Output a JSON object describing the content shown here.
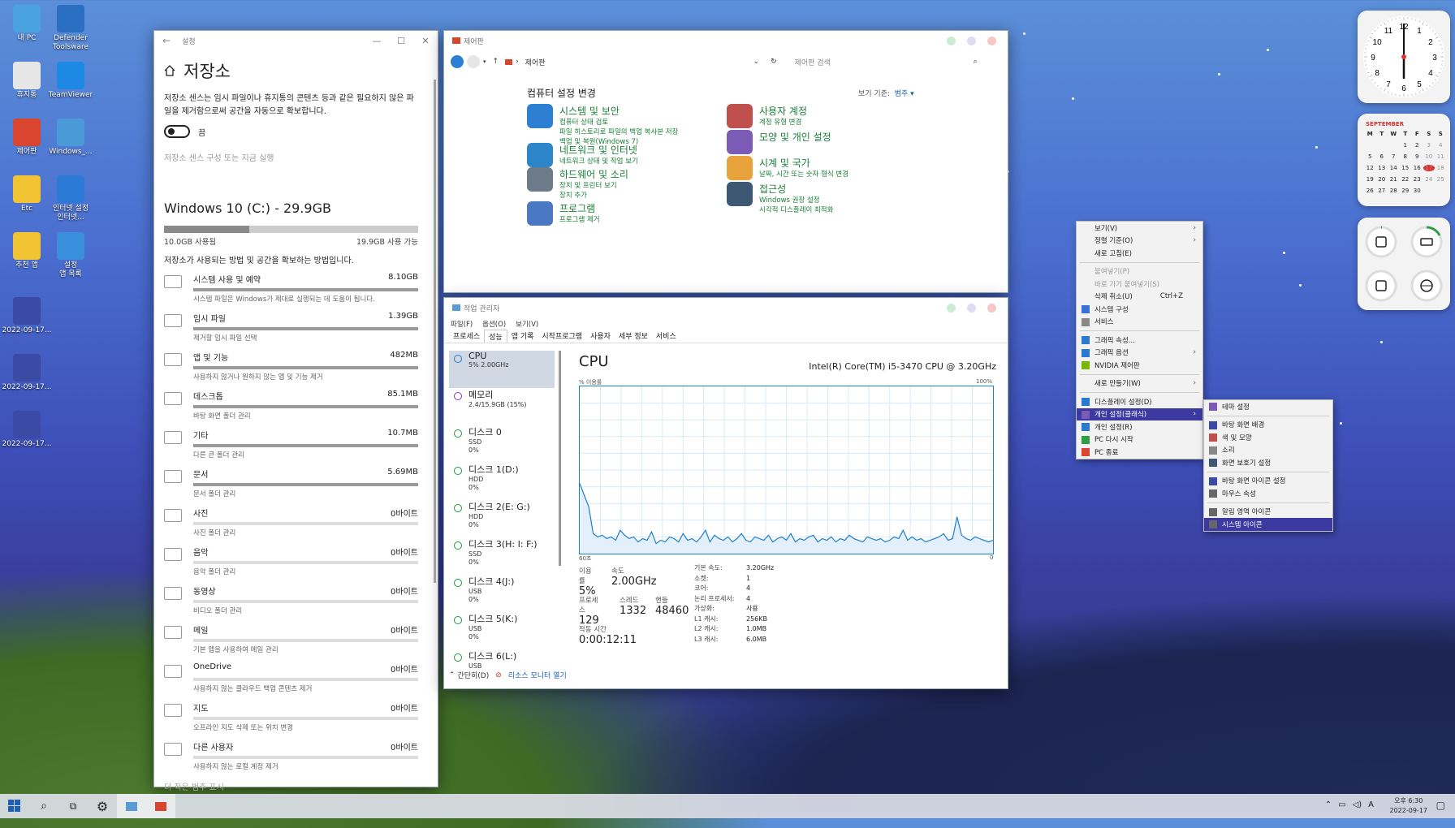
{
  "desktop": {
    "icons": [
      {
        "label": "내 PC",
        "color": "#4aa3df"
      },
      {
        "label": "Defender\nToolsware",
        "color": "#2b6fc2"
      },
      {
        "label": "휴지통",
        "color": "#e6e6e6"
      },
      {
        "label": "TeamViewer",
        "color": "#1e88e5"
      },
      {
        "label": "제어판",
        "color": "#d9452e"
      },
      {
        "label": "Windows_...",
        "color": "#4b9ad8"
      },
      {
        "label": "Etc",
        "color": "#f1c232"
      },
      {
        "label": "인터넷 설정\n인터넷...",
        "color": "#2b7bd6"
      },
      {
        "label": "추천 앱",
        "color": "#f1c232"
      },
      {
        "label": "설정\n앱 목록",
        "color": "#3a8fdc"
      },
      {
        "label": "2022-09-17...",
        "color": "#3b4aa5"
      },
      {
        "label": "2022-09-17...",
        "color": "#3b4aa5"
      },
      {
        "label": "2022-09-17...",
        "color": "#3b4aa5"
      }
    ]
  },
  "settings": {
    "window_title": "설정",
    "page_title": "저장소",
    "description": "저장소 센스는 임시 파일이나 휴지통의 콘텐츠 등과 같은 필요하지 않은 파일을 제거함으로써 공간을 자동으로 확보합니다.",
    "toggle_label": "끔",
    "config_link": "저장소 센스 구성 또는 지금 실행",
    "drive_title": "Windows 10 (C:) - 29.9GB",
    "drive_used_fraction": 0.335,
    "used_label": "10.0GB 사용됨",
    "free_label": "19.9GB 사용 가능",
    "usage_subtitle": "저장소가 사용되는 방법 및 공간을 확보하는 방법입니다.",
    "categories": [
      {
        "name": "시스템 사용 및 예약",
        "size": "8.10GB",
        "desc": "시스템 파일은 Windows가 제대로 실행되는 데 도움이 됩니다.",
        "fill": 1.0
      },
      {
        "name": "임시 파일",
        "size": "1.39GB",
        "desc": "제거할 임시 파일 선택",
        "fill": 1.0
      },
      {
        "name": "앱 및 기능",
        "size": "482MB",
        "desc": "사용하지 않거나 원하지 않는 앱 및 기능 제거",
        "fill": 1.0
      },
      {
        "name": "데스크톱",
        "size": "85.1MB",
        "desc": "바탕 화면 폴더 관리",
        "fill": 1.0
      },
      {
        "name": "기타",
        "size": "10.7MB",
        "desc": "다른 큰 폴더 관리",
        "fill": 1.0
      },
      {
        "name": "문서",
        "size": "5.69MB",
        "desc": "문서 폴더 관리",
        "fill": 1.0
      },
      {
        "name": "사진",
        "size": "0바이트",
        "desc": "사진 폴더 관리",
        "fill": 0.0
      },
      {
        "name": "음악",
        "size": "0바이트",
        "desc": "음악 폴더 관리",
        "fill": 0.0
      },
      {
        "name": "동영상",
        "size": "0바이트",
        "desc": "비디오 폴더 관리",
        "fill": 0.0
      },
      {
        "name": "메일",
        "size": "0바이트",
        "desc": "기본 앱을 사용하여 메일 관리",
        "fill": 0.0
      },
      {
        "name": "OneDrive",
        "size": "0바이트",
        "desc": "사용하지 않는 클라우드 백업 콘텐츠 제거",
        "fill": 0.0
      },
      {
        "name": "지도",
        "size": "0바이트",
        "desc": "오프라인 지도 삭제 또는 위치 변경",
        "fill": 0.0
      },
      {
        "name": "다른 사용자",
        "size": "0바이트",
        "desc": "사용하지 않는 로컬 계정 제거",
        "fill": 0.0
      }
    ],
    "more_link": "더 적은 범주 표시"
  },
  "control_panel": {
    "window_title": "제어판",
    "breadcrumb": "제어판",
    "search_placeholder": "제어판 검색",
    "heading": "컴퓨터 설정 변경",
    "view_by_label": "보기 기준:",
    "view_by_value": "범주 ▾",
    "items": [
      {
        "title": "시스템 및 보안",
        "links": [
          "컴퓨터 상태 검토",
          "파일 히스토리로 파일의 백업 복사본 저장",
          "백업 및 복원(Windows 7)"
        ],
        "color": "#2d7fd3"
      },
      {
        "title": "네트워크 및 인터넷",
        "links": [
          "네트워크 상태 및 작업 보기"
        ],
        "color": "#2c86c9"
      },
      {
        "title": "하드웨어 및 소리",
        "links": [
          "장치 및 프린터 보기",
          "장치 추가"
        ],
        "color": "#6c7a89"
      },
      {
        "title": "프로그램",
        "links": [
          "프로그램 제거"
        ],
        "color": "#4a78c2"
      },
      {
        "title": "사용자 계정",
        "links": [
          "계정 유형 변경"
        ],
        "color": "#c0504d"
      },
      {
        "title": "모양 및 개인 설정",
        "links": [],
        "color": "#7b5bb5"
      },
      {
        "title": "시계 및 국가",
        "links": [
          "날짜, 시간 또는 숫자 형식 변경"
        ],
        "color": "#e8a33d"
      },
      {
        "title": "접근성",
        "links": [
          "Windows 권장 설정",
          "시각적 디스플레이 최적화"
        ],
        "color": "#3e5873"
      }
    ]
  },
  "task_manager": {
    "window_title": "작업 관리자",
    "menu": [
      "파일(F)",
      "옵션(O)",
      "보기(V)"
    ],
    "tabs": [
      "프로세스",
      "성능",
      "앱 기록",
      "시작프로그램",
      "사용자",
      "세부 정보",
      "서비스"
    ],
    "active_tab": 1,
    "resources": [
      {
        "name": "CPU",
        "lines": [
          "5% 2.00GHz"
        ]
      },
      {
        "name": "메모리",
        "lines": [
          "2.4/15.9GB (15%)"
        ]
      },
      {
        "name": "디스크 0",
        "lines": [
          "SSD",
          "0%"
        ]
      },
      {
        "name": "디스크 1(D:)",
        "lines": [
          "HDD",
          "0%"
        ]
      },
      {
        "name": "디스크 2(E: G:)",
        "lines": [
          "HDD",
          "0%"
        ]
      },
      {
        "name": "디스크 3(H: I: F:)",
        "lines": [
          "SSD",
          "0%"
        ]
      },
      {
        "name": "디스크 4(J:)",
        "lines": [
          "USB",
          "0%"
        ]
      },
      {
        "name": "디스크 5(K:)",
        "lines": [
          "USB",
          "0%"
        ]
      },
      {
        "name": "디스크 6(L:)",
        "lines": [
          "USB"
        ]
      }
    ],
    "cpu_title": "CPU",
    "cpu_model": "Intel(R) Core(TM) i5-3470 CPU @ 3.20GHz",
    "graph_label": "% 이용률",
    "graph_max": "100%",
    "graph_time": "60초",
    "graph_min": "0",
    "graph_series": [
      42,
      35,
      28,
      12,
      10,
      11,
      9,
      10,
      8,
      14,
      11,
      9,
      10,
      7,
      9,
      8,
      13,
      6,
      8,
      7,
      10,
      9,
      7,
      12,
      8,
      9,
      7,
      10,
      14,
      7,
      11,
      9,
      8,
      10,
      7,
      9,
      12,
      8,
      7,
      10,
      9,
      8,
      11,
      7,
      9,
      10,
      8,
      12,
      7,
      9,
      8,
      10,
      11,
      7,
      9,
      8,
      10,
      7,
      9,
      8,
      11,
      9,
      8,
      7,
      10,
      9,
      8,
      9,
      7,
      8,
      10,
      9,
      14,
      8,
      10,
      8,
      9,
      7,
      8,
      9,
      10,
      12,
      8,
      9,
      22,
      11,
      9,
      8,
      10,
      9,
      8,
      7,
      8
    ],
    "stat_labels": {
      "util": "이용률",
      "speed": "속도",
      "proc": "프로세스",
      "thread": "스레드",
      "handle": "핸들",
      "uptime": "작동 시간"
    },
    "stat_values": {
      "util": "5%",
      "speed": "2.00GHz",
      "proc": "129",
      "thread": "1332",
      "handle": "48460",
      "uptime": "0:00:12:11"
    },
    "spec_labels": [
      "기본 속도:",
      "소켓:",
      "코어:",
      "논리 프로세서:",
      "가상화:",
      "L1 캐시:",
      "L2 캐시:",
      "L3 캐시:"
    ],
    "spec_values": [
      "3.20GHz",
      "1",
      "4",
      "4",
      "사용",
      "256KB",
      "1.0MB",
      "6.0MB"
    ],
    "footer_simple": "간단히(D)",
    "footer_link": "리소스 모니터 열기"
  },
  "context_menu": {
    "items": [
      {
        "label": "보기(V)",
        "arrow": true
      },
      {
        "label": "정렬 기준(O)",
        "arrow": true
      },
      {
        "label": "새로 고침(E)"
      },
      {
        "sep": true
      },
      {
        "label": "붙여넣기(P)",
        "disabled": true
      },
      {
        "label": "바로 가기 붙여넣기(S)",
        "disabled": true
      },
      {
        "label": "삭제 취소(U)",
        "shortcut": "Ctrl+Z"
      },
      {
        "label": "시스템 구성",
        "icon": "#3a6fd8"
      },
      {
        "label": "서비스",
        "icon": "#888"
      },
      {
        "sep": true
      },
      {
        "label": "그래픽 속성...",
        "icon": "#2a7ad1"
      },
      {
        "label": "그래픽 옵션",
        "icon": "#2a7ad1",
        "arrow": true
      },
      {
        "label": "NVIDIA 제어판",
        "icon": "#76b900"
      },
      {
        "sep": true
      },
      {
        "label": "새로 만들기(W)",
        "arrow": true
      },
      {
        "sep": true
      },
      {
        "label": "디스플레이 설정(D)",
        "icon": "#2a7ad1"
      },
      {
        "label": "개인 설정(클래식)",
        "icon": "#7b5bb5",
        "selected": true,
        "arrow": true
      },
      {
        "label": "개인 설정(R)",
        "icon": "#2a7ad1"
      },
      {
        "label": "PC 다시 시작",
        "icon": "#2ea043"
      },
      {
        "label": "PC 종료",
        "icon": "#d9452e"
      }
    ],
    "submenu": [
      {
        "label": "테마 설정",
        "icon": "#7b5bb5"
      },
      {
        "sep": true
      },
      {
        "label": "바탕 화면 배경",
        "icon": "#3b4aa5"
      },
      {
        "label": "색 및 모양",
        "icon": "#c0504d"
      },
      {
        "label": "소리",
        "icon": "#888"
      },
      {
        "label": "화면 보호기 설정",
        "icon": "#3e5873"
      },
      {
        "sep": true
      },
      {
        "label": "바탕 화면 아이콘 설정",
        "icon": "#3b4aa5"
      },
      {
        "label": "마우스 속성",
        "icon": "#666"
      },
      {
        "sep": true
      },
      {
        "label": "알림 영역 아이콘",
        "icon": "#666"
      },
      {
        "label": "시스템 아이콘",
        "icon": "#666",
        "selected": true
      }
    ]
  },
  "calendar_widget": {
    "month": "SEPTEMBER",
    "weekdays": [
      "M",
      "T",
      "W",
      "T",
      "F",
      "S",
      "S"
    ],
    "days": [
      "",
      "",
      "",
      "1",
      "2",
      "3",
      "4",
      "5",
      "6",
      "7",
      "8",
      "9",
      "10",
      "11",
      "12",
      "13",
      "14",
      "15",
      "16",
      "17",
      "18",
      "19",
      "20",
      "21",
      "22",
      "23",
      "24",
      "25",
      "26",
      "27",
      "28",
      "29",
      "30",
      "",
      ""
    ],
    "today": "17"
  },
  "clock_widget": {
    "numbers": [
      "12",
      "1",
      "2",
      "3",
      "4",
      "5",
      "6",
      "7",
      "8",
      "9",
      "10",
      "11"
    ]
  },
  "taskbar": {
    "time": "오후 6:30",
    "date": "2022-09-17",
    "ime": "A"
  },
  "colors": {
    "accent": "#3b3aa0",
    "link_green": "#1a7f37",
    "graph_line": "#1e7fcf"
  }
}
